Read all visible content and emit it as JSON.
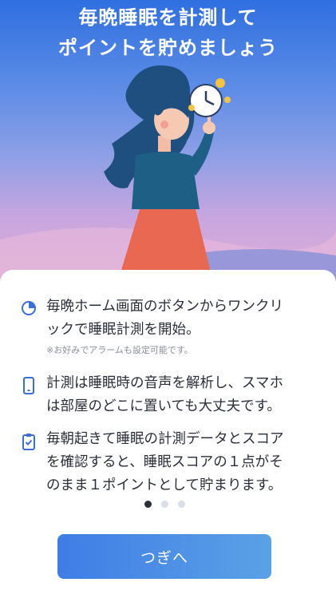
{
  "hero": {
    "title_line1": "毎晩睡眠を計測して",
    "title_line2": "ポイントを貯めましょう"
  },
  "features": [
    {
      "icon": "pie-chart-icon",
      "lines": [
        "毎晩ホーム画面のボタンからワンクリ",
        "ックで睡眠計測を開始。"
      ],
      "note": "※お好みでアラームも設定可能です。"
    },
    {
      "icon": "smartphone-icon",
      "lines": [
        "計測は睡眠時の音声を解析し、スマホ",
        "は部屋のどこに置いても大丈夫です。"
      ]
    },
    {
      "icon": "clipboard-check-icon",
      "lines": [
        "毎朝起きて睡眠の計測データとスコア",
        "を確認すると、睡眠スコアの１点がそ",
        "のまま１ポイントとして貯まります。"
      ]
    }
  ],
  "pagination": {
    "total": 3,
    "current": 1
  },
  "next_button": {
    "label": "つぎへ"
  },
  "colors": {
    "accent": "#3f7de6",
    "icon": "#3b6fd8",
    "text": "#2b2f3a"
  }
}
